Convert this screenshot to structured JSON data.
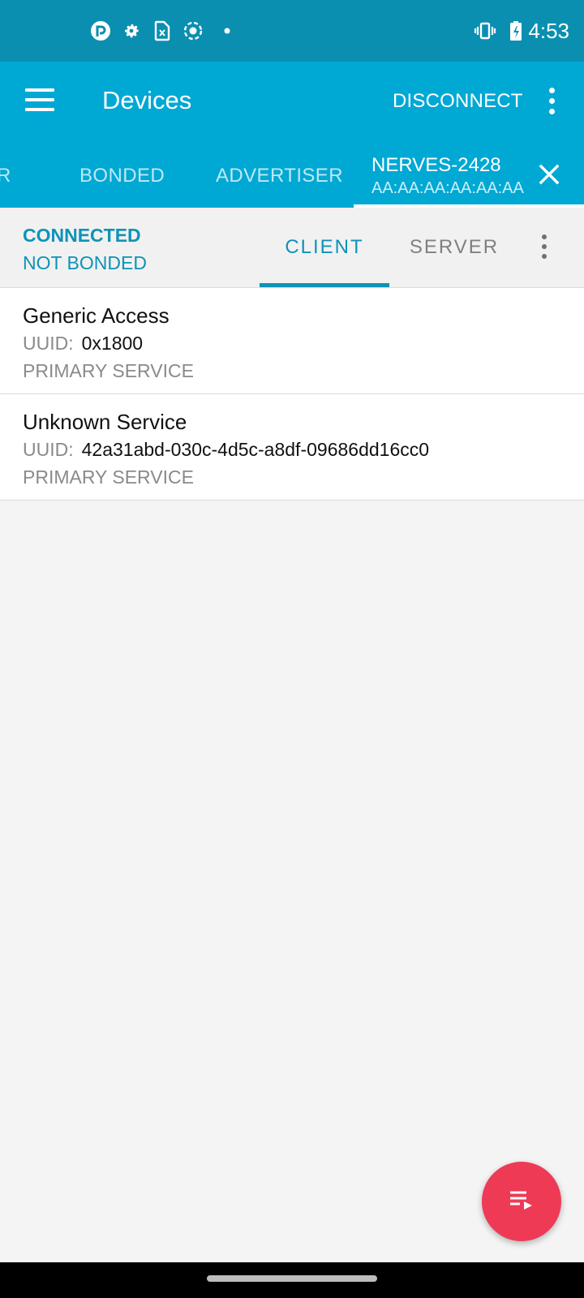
{
  "status_bar": {
    "time": "4:53",
    "left_icons": [
      "pocket-casts-icon",
      "settings-icon",
      "sim-card-icon",
      "screen-record-icon",
      "notification-dot-icon"
    ],
    "right_icons": [
      "vibrate-icon",
      "battery-charging-icon"
    ]
  },
  "app_bar": {
    "title": "Devices",
    "disconnect_label": "DISCONNECT",
    "background_color": "#00a8d4"
  },
  "device_tabs": {
    "partial_label": "R",
    "bonded_label": "BONDED",
    "advertiser_label": "ADVERTISER",
    "active_device": {
      "name": "NERVES-2428",
      "mac": "AA:AA:AA:AA:AA:AA"
    }
  },
  "connection": {
    "state": "CONNECTED",
    "bond_state": "NOT BONDED",
    "tabs": [
      "CLIENT",
      "SERVER"
    ],
    "active_tab": "CLIENT",
    "accent_color": "#0d93b8"
  },
  "services": [
    {
      "name": "Generic Access",
      "uuid_label": "UUID:",
      "uuid": "0x1800",
      "type": "PRIMARY SERVICE"
    },
    {
      "name": "Unknown Service",
      "uuid_label": "UUID:",
      "uuid": "42a31abd-030c-4d5c-a8df-09686dd16cc0",
      "type": "PRIMARY SERVICE"
    }
  ],
  "fab": {
    "icon": "log-playlist-icon",
    "color": "#ee3a55"
  }
}
